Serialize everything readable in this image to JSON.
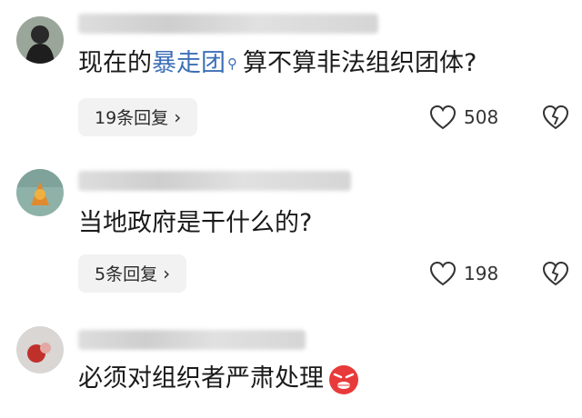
{
  "comments": [
    {
      "text_before": "现在的",
      "link": "暴走团",
      "text_after": "算不算非法组织团体?",
      "reply_label": "19条回复",
      "likes": "508"
    },
    {
      "text": "当地政府是干什么的?",
      "reply_label": "5条回复",
      "likes": "198"
    },
    {
      "text": "必须对组织者严肃处理",
      "emoji": "angry-face-icon"
    }
  ]
}
